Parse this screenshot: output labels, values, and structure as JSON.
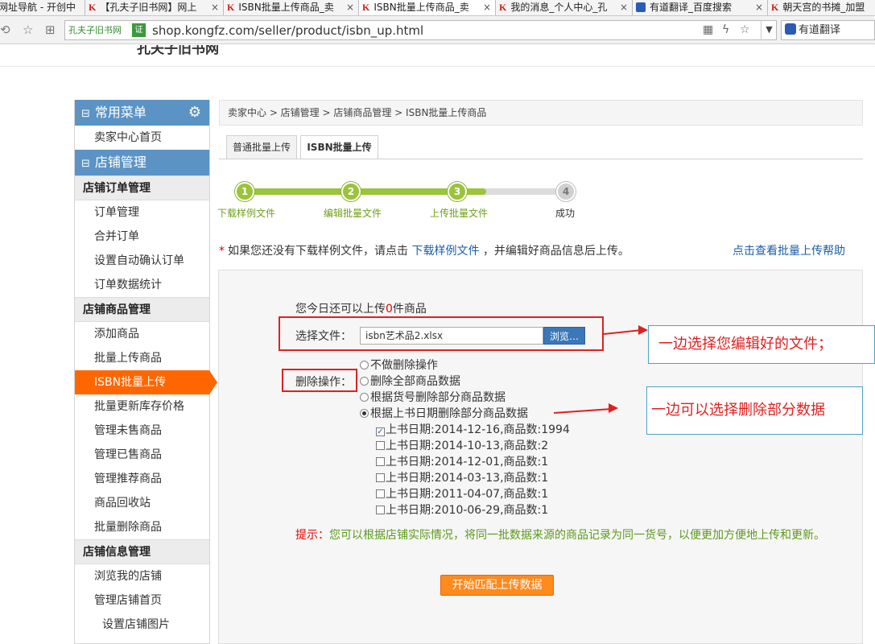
{
  "browser": {
    "tabs": [
      {
        "label": "网址导航 - 开创中",
        "icon": "page-icon"
      },
      {
        "label": "【孔夫子旧书网】网上",
        "icon": "kongfz-icon"
      },
      {
        "label": "ISBN批量上传商品_卖",
        "icon": "kongfz-icon"
      },
      {
        "label": "ISBN批量上传商品_卖",
        "icon": "kongfz-icon"
      },
      {
        "label": "我的消息_个人中心_孔",
        "icon": "kongfz-icon"
      },
      {
        "label": "有道翻译_百度搜索",
        "icon": "baidu-paw-icon"
      },
      {
        "label": "朝天宫的书摊_加盟",
        "icon": "kongfz-icon"
      }
    ],
    "tab_close": "×",
    "site_name": "孔夫子旧书网",
    "cert_badge": "证",
    "url": "shop.kongfz.com/seller/product/isbn_up.html",
    "search_text": "有道翻译",
    "dropdown_glyph": "▼"
  },
  "header": {
    "logo_fragment": "孔夫子旧书网"
  },
  "sidebar": {
    "sections": [
      {
        "header": "常用菜单",
        "icon": "gear-icon",
        "items": [
          "卖家中心首页"
        ]
      },
      {
        "header": "店铺管理"
      }
    ],
    "groups": [
      {
        "title": "店铺订单管理",
        "items": [
          "订单管理",
          "合并订单",
          "设置自动确认订单",
          "订单数据统计"
        ]
      },
      {
        "title": "店铺商品管理",
        "items": [
          "添加商品",
          "批量上传商品",
          "ISBN批量上传",
          "批量更新库存价格",
          "管理未售商品",
          "管理已售商品",
          "管理推荐商品",
          "商品回收站",
          "批量删除商品"
        ]
      },
      {
        "title": "店铺信息管理",
        "items": [
          "浏览我的店铺",
          "管理店铺首页",
          "设置店铺图片"
        ]
      }
    ],
    "active_item": "ISBN批量上传"
  },
  "main": {
    "breadcrumb": "卖家中心 > 店铺管理 > 店铺商品管理 > ISBN批量上传商品",
    "tabs": [
      "普通批量上传",
      "ISBN批量上传"
    ],
    "active_tab": "ISBN批量上传",
    "steps": [
      {
        "num": "1",
        "label": "下载样例文件",
        "done": true
      },
      {
        "num": "2",
        "label": "编辑批量文件",
        "done": true
      },
      {
        "num": "3",
        "label": "上传批量文件",
        "done": true
      },
      {
        "num": "4",
        "label": "成功",
        "done": false
      }
    ],
    "notice": {
      "star": "*",
      "pre": "如果您还没有下载样例文件，请点击",
      "link": "下载样例文件",
      "post": "，并编辑好商品信息后上传。"
    },
    "help_link": "点击查看批量上传帮助",
    "quota": {
      "pre": "您今日还可以上传",
      "count": "0",
      "post": "件商品"
    },
    "file": {
      "label": "选择文件：",
      "value": "isbn艺术品2.xlsx",
      "browse": "浏览…"
    },
    "delete": {
      "label": "删除操作：",
      "options": [
        "不做删除操作",
        "删除全部商品数据",
        "根据货号删除部分商品数据",
        "根据上书日期删除部分商品数据"
      ],
      "selected_index": 3,
      "dates": [
        {
          "text": "上书日期:2014-12-16,商品数:1994",
          "checked": true
        },
        {
          "text": "上书日期:2014-10-13,商品数:2",
          "checked": false
        },
        {
          "text": "上书日期:2014-12-01,商品数:1",
          "checked": false
        },
        {
          "text": "上书日期:2014-03-13,商品数:1",
          "checked": false
        },
        {
          "text": "上书日期:2011-04-07,商品数:1",
          "checked": false
        },
        {
          "text": "上书日期:2010-06-29,商品数:1",
          "checked": false
        }
      ]
    },
    "tip": {
      "label": "提示：",
      "text": "您可以根据店铺实际情况，将同一批数据来源的商品记录为同一货号，以便更加方便地上传和更新。"
    },
    "start_button": "开始匹配上传数据"
  },
  "annotations": {
    "callout_1": "一边选择您编辑好的文件；",
    "callout_2": "一边可以选择删除部分数据",
    "color": "#e02020"
  }
}
